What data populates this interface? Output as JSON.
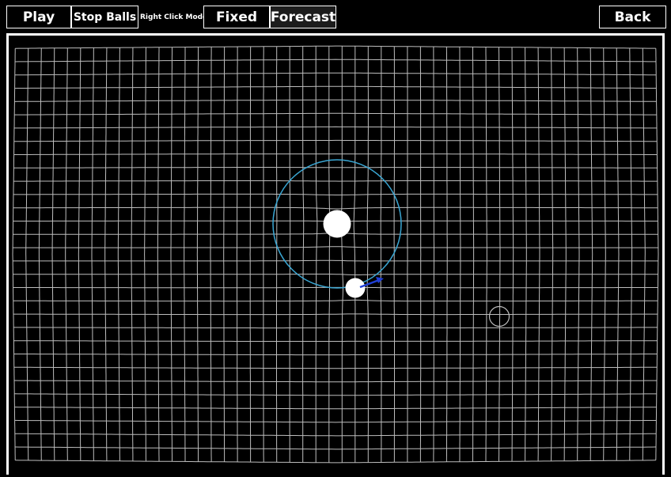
{
  "toolbar": {
    "play_label": "Play",
    "stop_balls_label": "Stop Balls",
    "right_click_mode_label": "Right Click Mode",
    "fixed_label": "Fixed",
    "forecast_label": "Forecast",
    "back_label": "Back"
  },
  "colors": {
    "grid": "#bdbdbd",
    "orbit": "#3aa7d4",
    "velocity_arrow": "#1f3fd6",
    "ball": "#ffffff",
    "background": "#000000"
  },
  "icons": {
    "ghost_ball": "circle-outline-icon"
  }
}
